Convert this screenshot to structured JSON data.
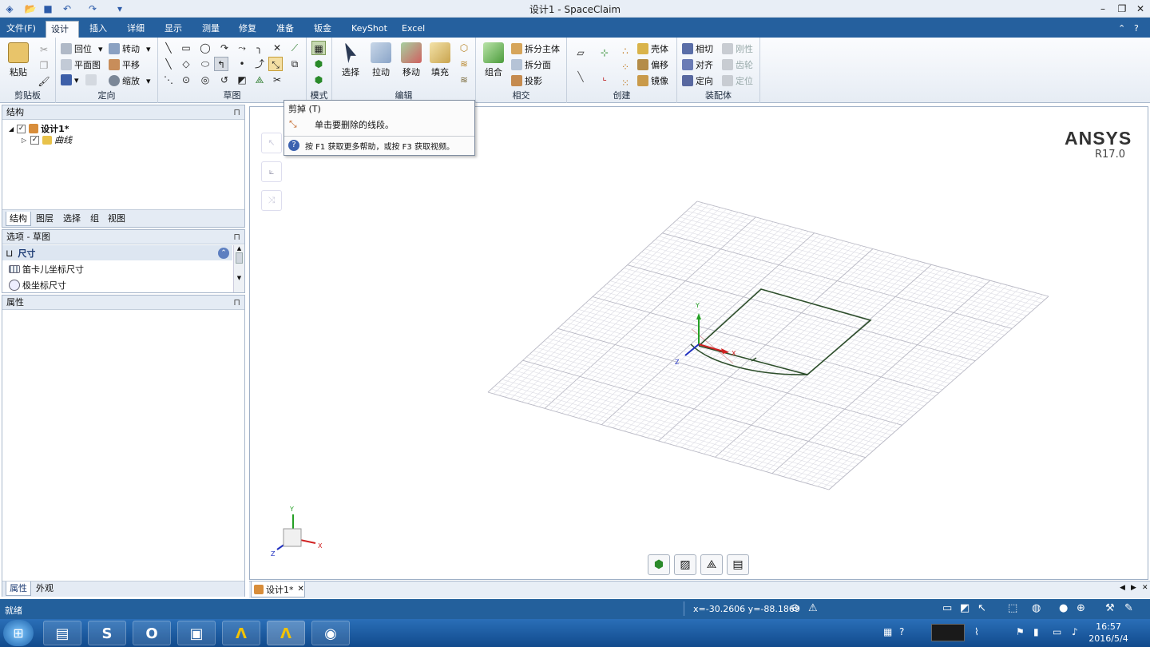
{
  "window": {
    "title": "设计1 - SpaceClaim"
  },
  "menu_tabs": [
    {
      "label": "文件(F)"
    },
    {
      "label": "设计"
    },
    {
      "label": "插入"
    },
    {
      "label": "详细"
    },
    {
      "label": "显示"
    },
    {
      "label": "测量"
    },
    {
      "label": "修复"
    },
    {
      "label": "准备"
    },
    {
      "label": "钣金"
    },
    {
      "label": "KeyShot"
    },
    {
      "label": "Excel"
    }
  ],
  "ribbon": {
    "clipboard": {
      "label": "剪贴板",
      "paste": "粘贴"
    },
    "orient": {
      "label": "定向",
      "home": "回位",
      "plan": "平面图",
      "spin": "转动",
      "pan": "平移",
      "zoom": "缩放"
    },
    "sketch": {
      "label": "草图"
    },
    "mode": {
      "label": "模式"
    },
    "edit": {
      "label": "编辑",
      "select": "选择",
      "pull": "拉动",
      "move": "移动",
      "fill": "填充"
    },
    "intersect": {
      "label": "相交",
      "combine": "组合",
      "split_body": "拆分主体",
      "split_face": "拆分面",
      "project": "投影"
    },
    "create": {
      "label": "创建",
      "shell": "壳体",
      "offset": "偏移",
      "mirror": "镜像"
    },
    "assembly": {
      "label": "装配体",
      "tangent": "相切",
      "align": "对齐",
      "orient": "定向",
      "rigid": "刚性",
      "gear": "齿轮",
      "anchor": "定位"
    }
  },
  "structure_panel": {
    "title": "结构",
    "root": "设计1*",
    "child": "曲线",
    "tabs": [
      "结构",
      "图层",
      "选择",
      "组",
      "视图"
    ]
  },
  "options_panel": {
    "title": "选项 - 草图",
    "section": "尺寸",
    "items": [
      "笛卡儿坐标尺寸",
      "极坐标尺寸"
    ]
  },
  "properties_panel": {
    "title": "属性",
    "tabs": [
      "属性",
      "外观"
    ]
  },
  "tooltip": {
    "title": "剪掉 (T)",
    "description": "单击要删除的线段。",
    "help": "按 F1 获取更多帮助，或按 F3 获取视频。"
  },
  "viewport": {
    "brand": "ANSYS",
    "version": "R17.0",
    "axis_x": "X",
    "axis_y": "Y",
    "axis_z": "Z"
  },
  "doc_tab": {
    "label": "设计1*"
  },
  "status": {
    "text": "就绪",
    "coords": "x=-30.2606  y=-88.1869"
  },
  "clock": {
    "time": "16:57",
    "date": "2016/5/4"
  },
  "colors": {
    "accent": "#25609e",
    "sketch_line": "#2d4e2b"
  }
}
